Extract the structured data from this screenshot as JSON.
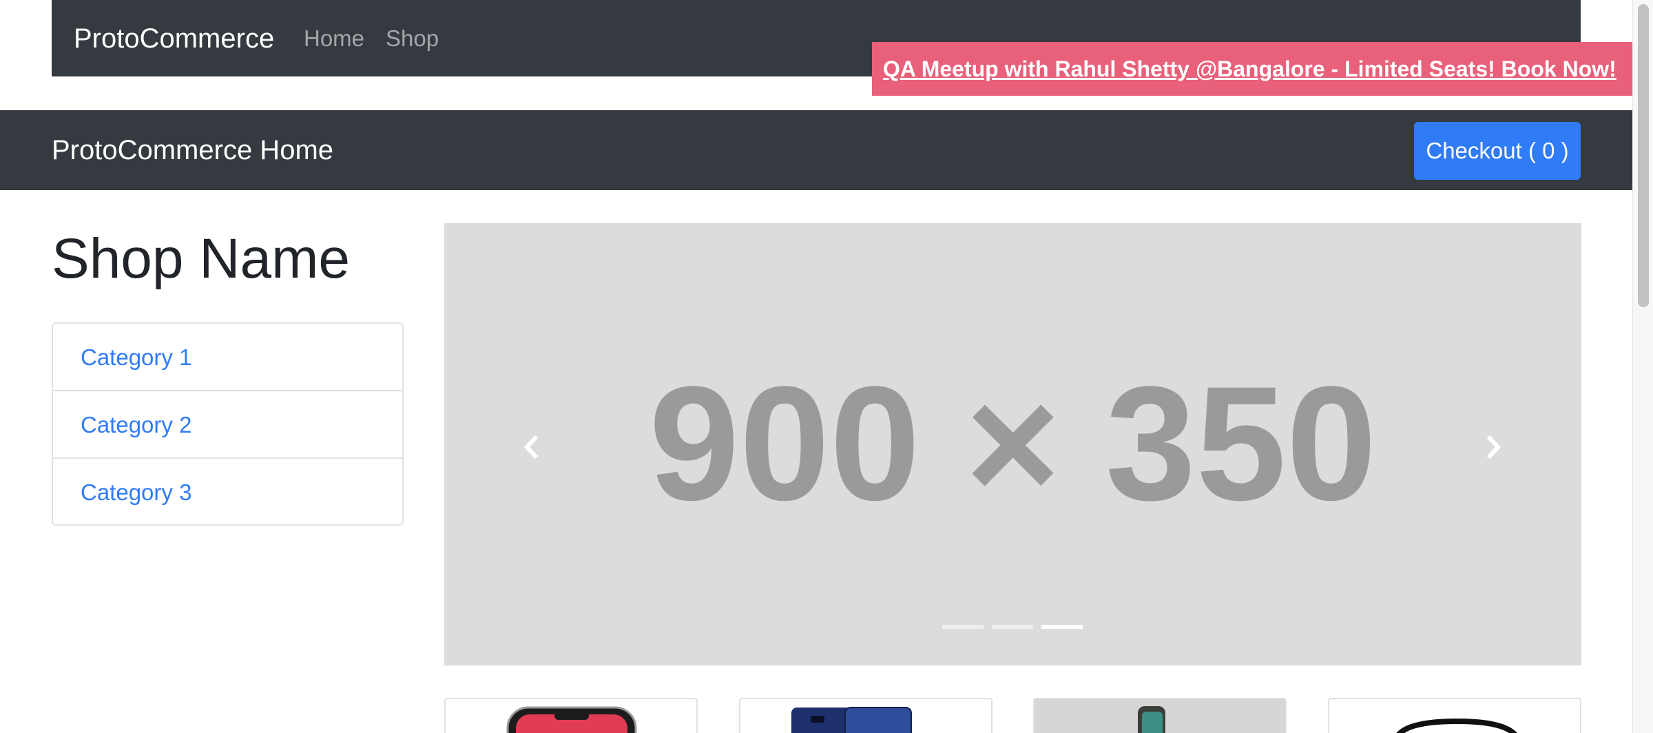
{
  "top_nav": {
    "brand": "ProtoCommerce",
    "links": [
      "Home",
      "Shop"
    ]
  },
  "promo": {
    "text": "QA Meetup with Rahul Shetty @Bangalore - Limited Seats! Book Now!",
    "color": "#e9607a"
  },
  "home_bar": {
    "title": "ProtoCommerce Home",
    "checkout_label": "Checkout ( 0 )"
  },
  "sidebar": {
    "shop_name": "Shop Name",
    "categories": [
      "Category 1",
      "Category 2",
      "Category 3"
    ]
  },
  "carousel": {
    "placeholder_text": "900 × 350",
    "prev_icon": "chevron-left-icon",
    "next_icon": "chevron-right-icon",
    "slide_count": 3,
    "active_slide": 3
  },
  "colors": {
    "navbar": "#343a40",
    "primary": "#2f7cf6",
    "carousel_bg": "#dcdcdc"
  }
}
